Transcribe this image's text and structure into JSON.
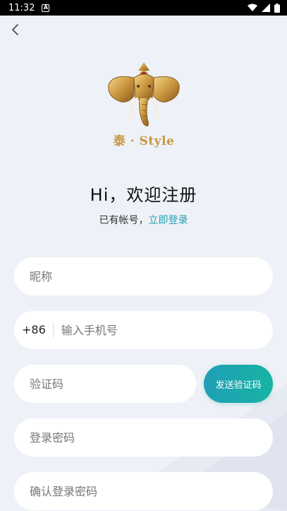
{
  "status_bar": {
    "time": "11:32",
    "notification_icon": "A"
  },
  "logo": {
    "text": "泰 · Style"
  },
  "header": {
    "title": "Hi，欢迎注册",
    "subtitle_prefix": "已有帐号，",
    "login_link": "立即登录"
  },
  "form": {
    "nickname_placeholder": "昵称",
    "country_code": "+86",
    "phone_placeholder": "输入手机号",
    "code_placeholder": "验证码",
    "send_code_label": "发送验证码",
    "password_placeholder": "登录密码",
    "confirm_password_placeholder": "确认登录密码"
  },
  "colors": {
    "accent": "#1aa1b0",
    "button_gradient_start": "#1f9fb6",
    "button_gradient_end": "#18b3a3",
    "background": "#eef1f7",
    "logo_gold": "#c9973f"
  }
}
